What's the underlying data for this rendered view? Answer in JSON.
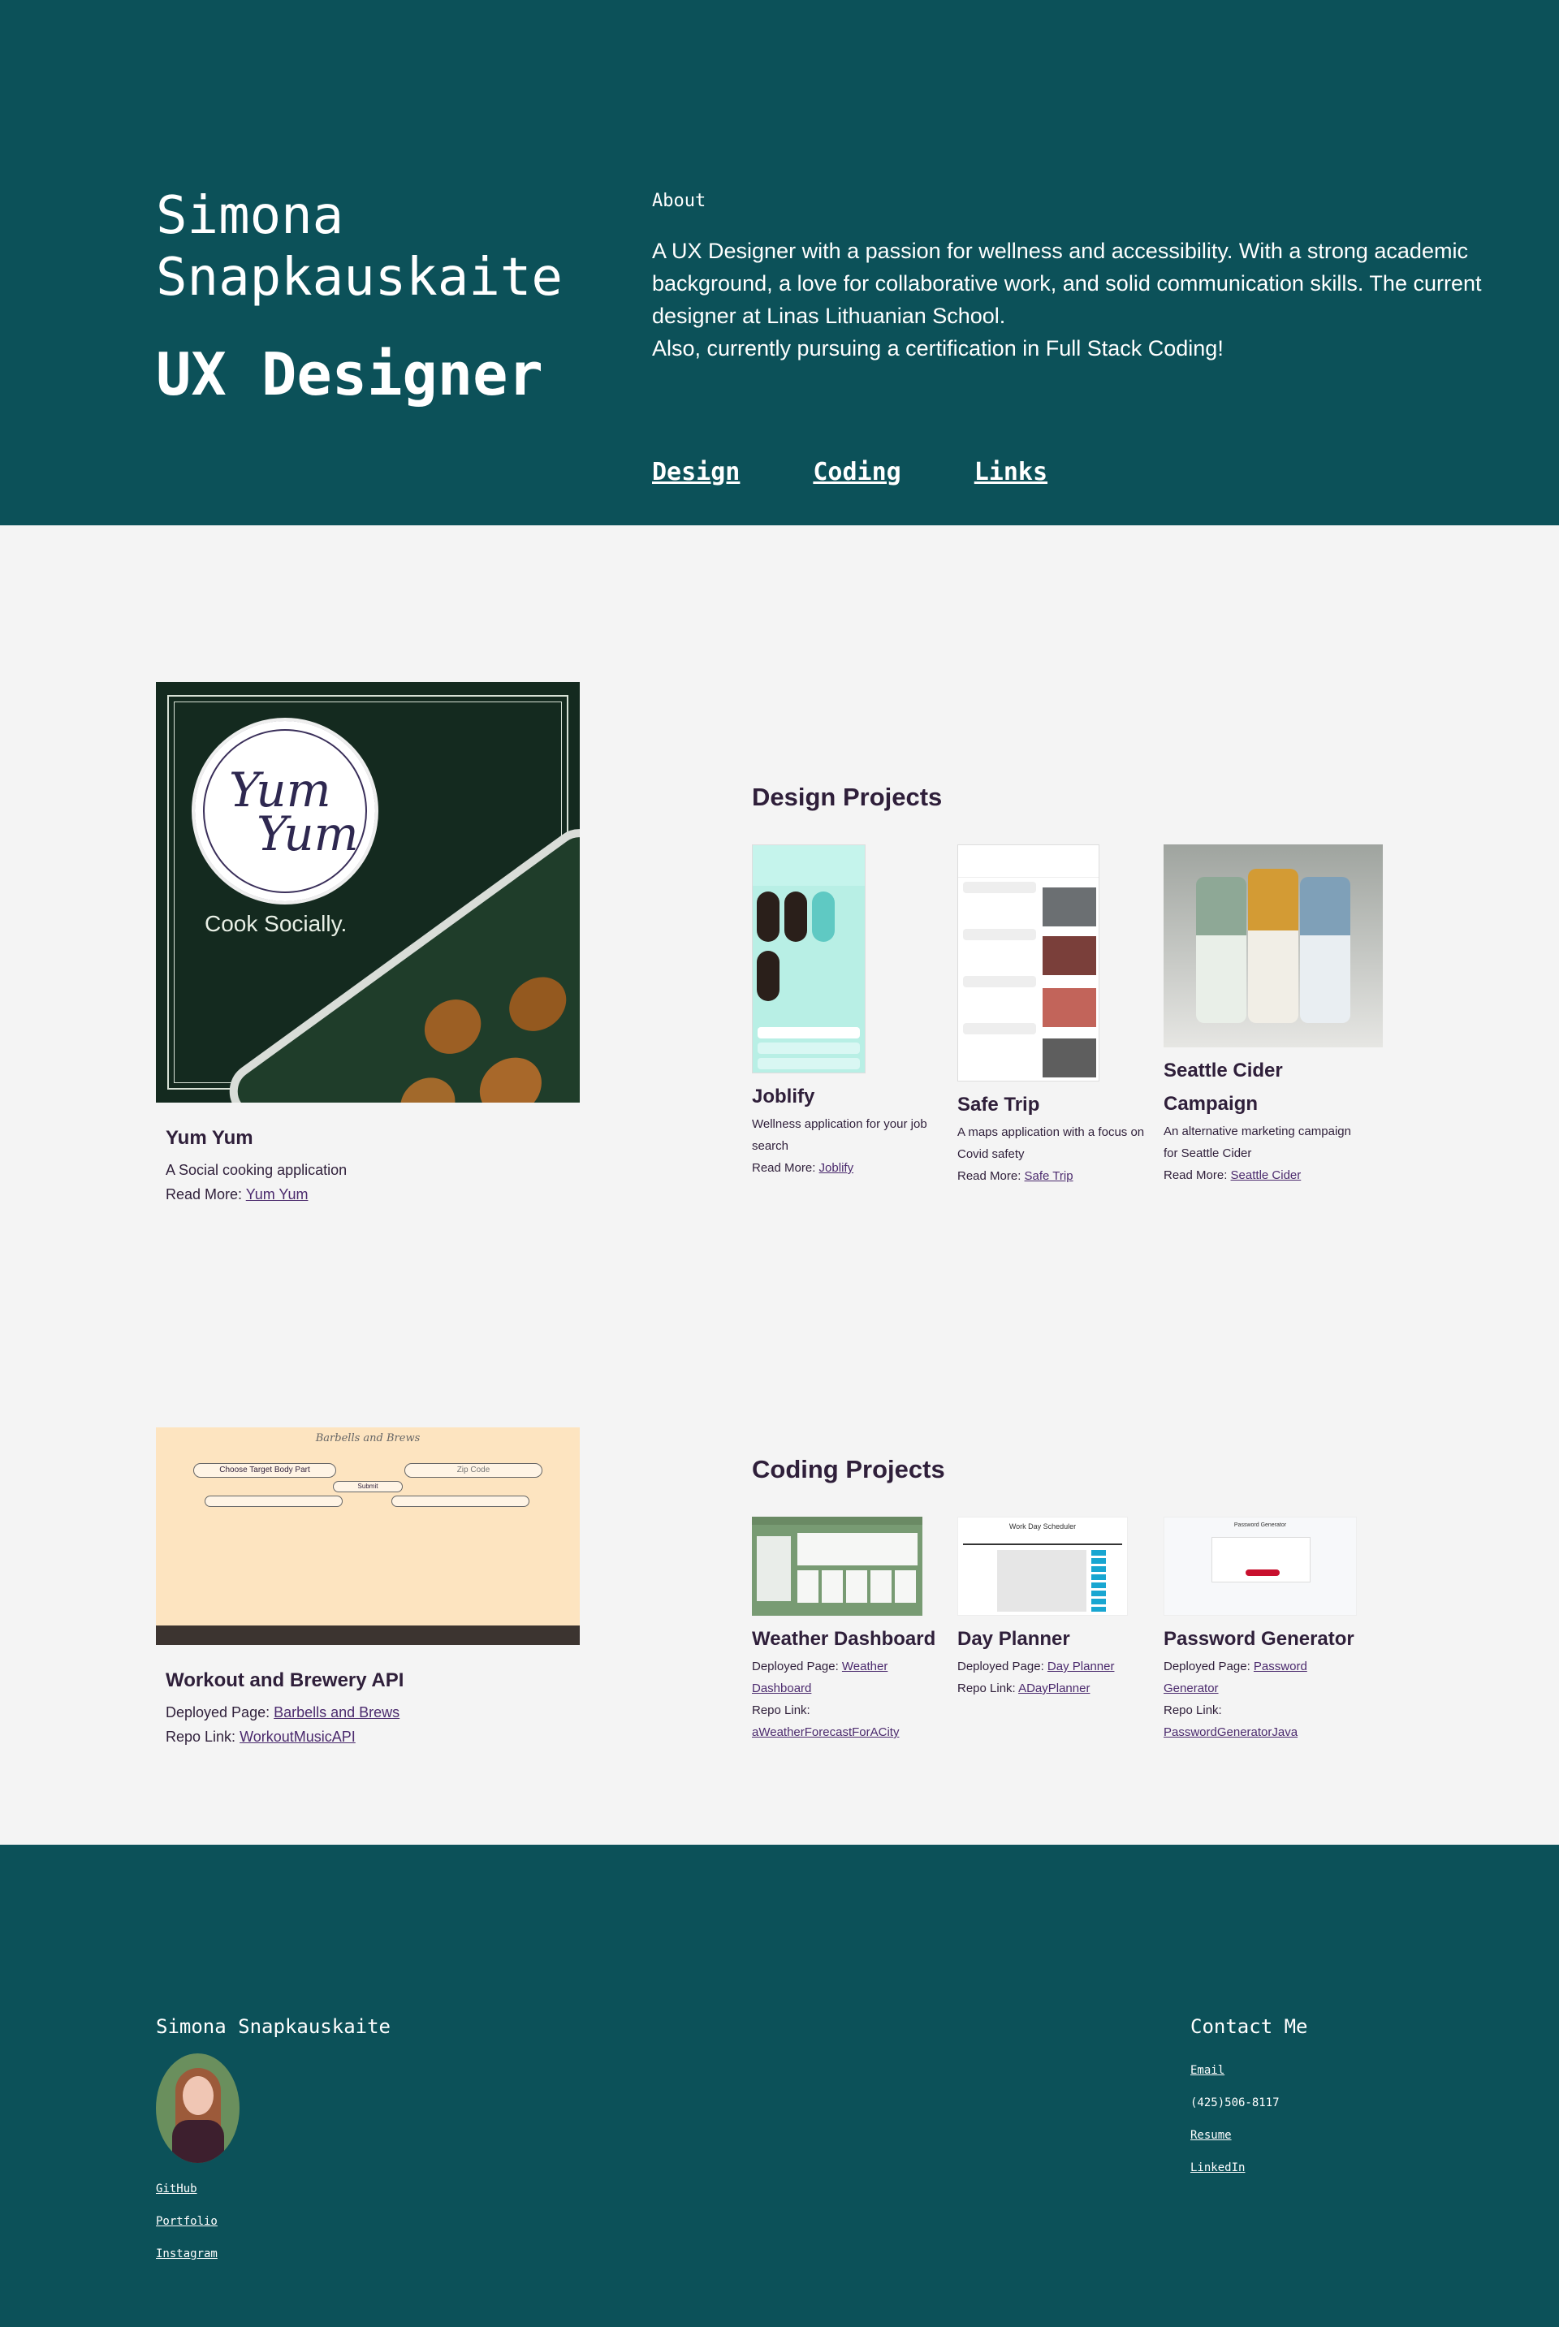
{
  "header": {
    "name": "Simona Snapkauskaite",
    "role": "UX Designer",
    "about_heading": "About",
    "about_text_1": "A UX Designer with a passion for wellness and accessibility. With a strong academic background, a love for collaborative work, and solid communication skills. The current designer at Linas Lithuanian School.",
    "about_text_2": "Also, currently pursuing a certification in Full Stack Coding!",
    "nav": [
      "Design",
      "Coding",
      "Links"
    ]
  },
  "featured_design": {
    "logo_text_1": "Yum",
    "logo_text_2": "Yum",
    "tagline": "Cook Socially.",
    "title": "Yum Yum",
    "desc": "A Social cooking application",
    "read_more": "Read More:",
    "link": "Yum Yum"
  },
  "design_projects": {
    "heading": "Design Projects",
    "items": [
      {
        "title": "Joblify",
        "desc": "Wellness application for your job search",
        "read_more": "Read More:",
        "link": "Joblify"
      },
      {
        "title": "Safe Trip",
        "desc": "A maps application with a focus on Covid safety",
        "read_more": "Read More:",
        "link": "Safe Trip"
      },
      {
        "title": "Seattle Cider Campaign",
        "desc": "An alternative marketing campaign for Seattle Cider",
        "read_more": "Read More:",
        "link": "Seattle Cider"
      }
    ]
  },
  "featured_coding": {
    "site_title": "Barbells and Brews",
    "select_label": "Choose Target Body Part",
    "zip_placeholder": "Zip Code",
    "submit": "Submit",
    "title": "Workout and Brewery API",
    "deployed_label": "Deployed Page:",
    "deployed_link": "Barbells and Brews",
    "repo_label": "Repo Link:",
    "repo_link": "WorkoutMusicAPI"
  },
  "coding_projects": {
    "heading": "Coding Projects",
    "items": [
      {
        "title": "Weather Dashboard",
        "deployed_label": "Deployed Page:",
        "deployed_link": "Weather Dashboard",
        "repo_label": "Repo Link:",
        "repo_link": "aWeatherForecastForACity"
      },
      {
        "title": "Day Planner",
        "deployed_label": "Deployed Page:",
        "deployed_link": "Day Planner",
        "repo_label": "Repo Link:",
        "repo_link": "ADayPlanner",
        "screen_title": "Work Day Scheduler"
      },
      {
        "title": "Password Generator",
        "deployed_label": "Deployed Page:",
        "deployed_link": "Password Generator",
        "repo_label": "Repo Link:",
        "repo_link": "PasswordGeneratorJava",
        "screen_title": "Password Generator"
      }
    ]
  },
  "footer": {
    "name": "Simona Snapkauskaite",
    "links": [
      "GitHub",
      "Portfolio",
      "Instagram"
    ],
    "contact_heading": "Contact Me",
    "email": "Email",
    "phone": "(425)506-8117",
    "resume": "Resume",
    "linkedin": "LinkedIn"
  },
  "colors": {
    "header_bg": "#0c5159",
    "text_dark": "#2f1f3a",
    "link": "#4b2a6d"
  }
}
